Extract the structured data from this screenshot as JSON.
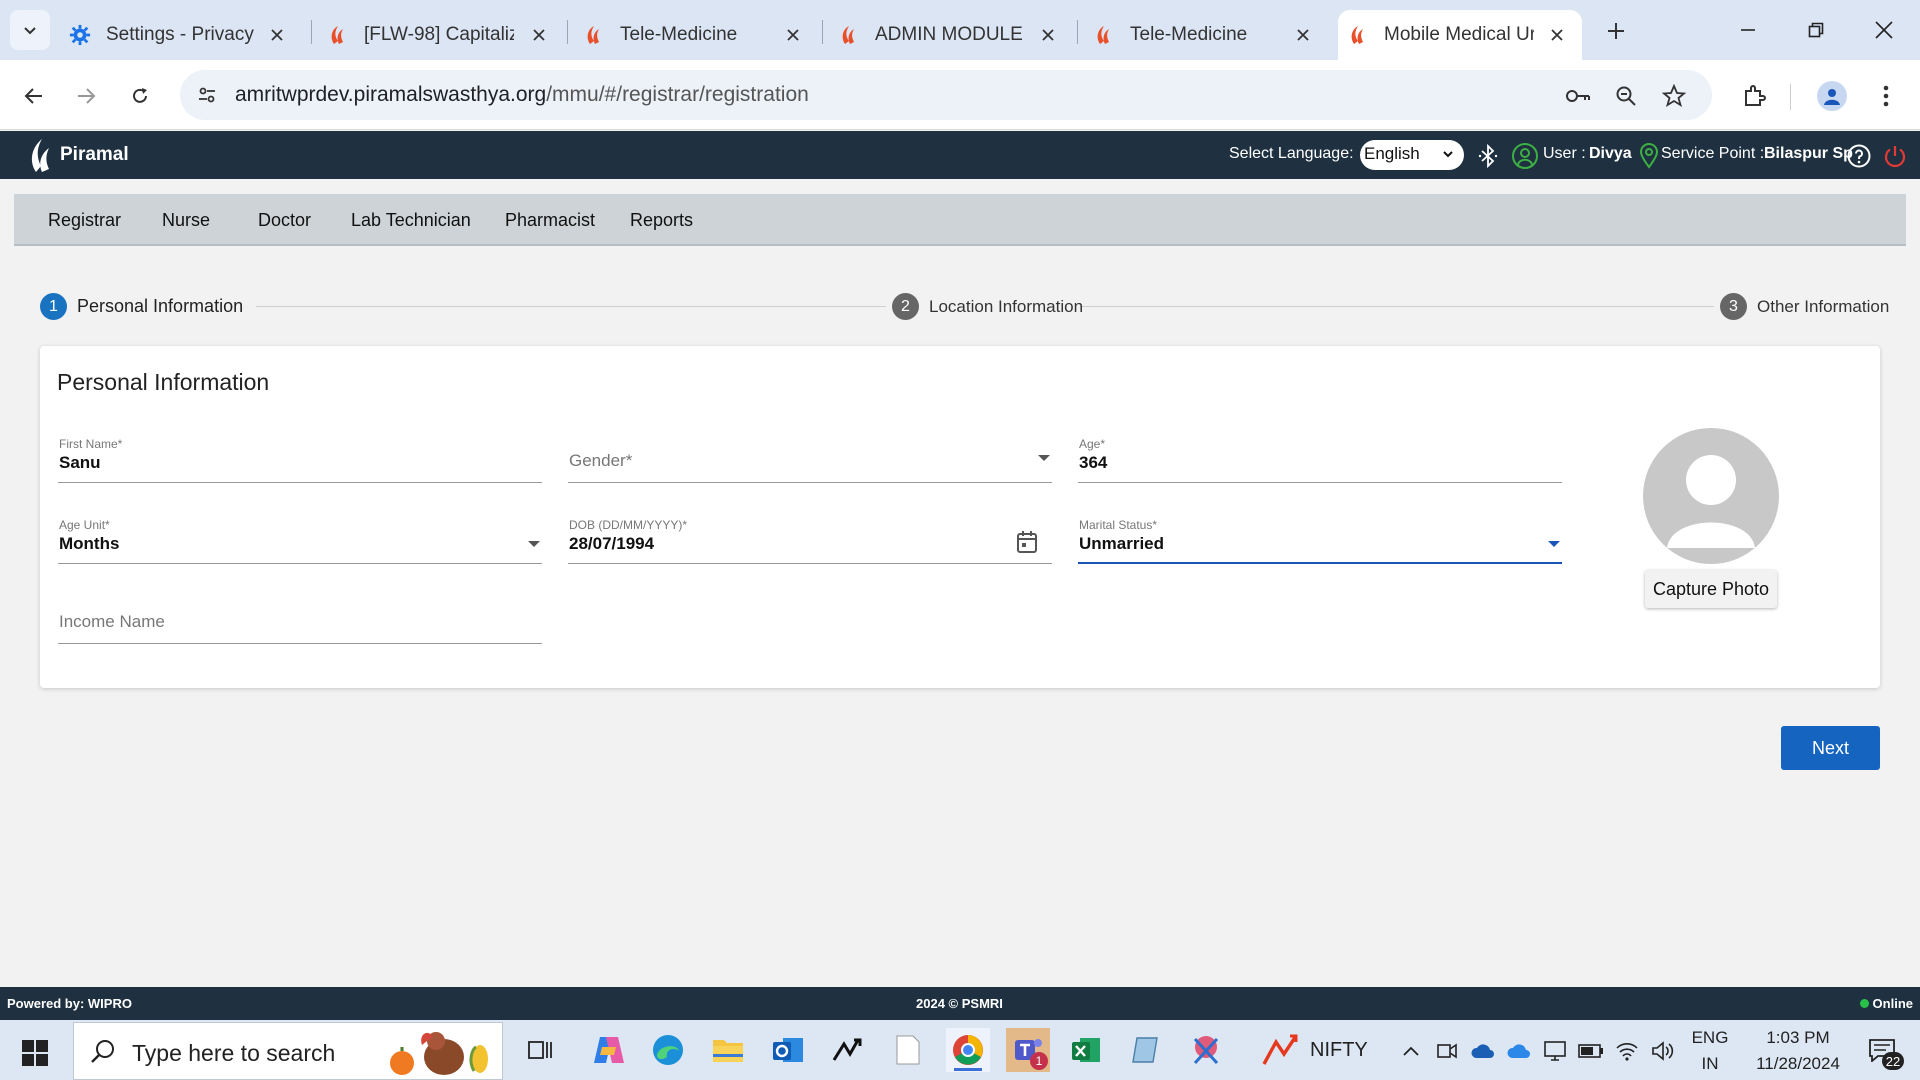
{
  "browser": {
    "tabs": [
      {
        "title": "Settings - Privacy a",
        "icon": "gear-icon"
      },
      {
        "title": "[FLW-98] Capitaliz",
        "icon": "piramal-icon"
      },
      {
        "title": "Tele-Medicine",
        "icon": "piramal-icon"
      },
      {
        "title": "ADMIN MODULE",
        "icon": "piramal-icon"
      },
      {
        "title": "Tele-Medicine",
        "icon": "piramal-icon"
      },
      {
        "title": "Mobile Medical Ur",
        "icon": "piramal-icon"
      }
    ],
    "active_tab_index": 5,
    "url_host": "amritwprdev.piramalswasthya.org",
    "url_path": "/mmu/#/registrar/registration"
  },
  "app_header": {
    "logo_text": "Piramal",
    "select_language_label": "Select Language:",
    "language_value": "English",
    "user_label": "User :",
    "user_name": "Divya",
    "service_point_label": "Service Point :",
    "service_point_value": "Bilaspur Sp"
  },
  "menu": {
    "items": [
      "Registrar",
      "Nurse",
      "Doctor",
      "Lab Technician",
      "Pharmacist",
      "Reports"
    ]
  },
  "stepper": {
    "steps": [
      {
        "num": "1",
        "label": "Personal Information",
        "active": true
      },
      {
        "num": "2",
        "label": "Location Information",
        "active": false
      },
      {
        "num": "3",
        "label": "Other Information",
        "active": false
      }
    ]
  },
  "form": {
    "title": "Personal Information",
    "first_name": {
      "label": "First Name*",
      "value": "Sanu"
    },
    "gender": {
      "placeholder": "Gender*",
      "value": ""
    },
    "age": {
      "label": "Age*",
      "value": "364"
    },
    "age_unit": {
      "label": "Age Unit*",
      "value": "Months"
    },
    "dob": {
      "label": "DOB (DD/MM/YYYY)*",
      "value": "28/07/1994"
    },
    "marital_status": {
      "label": "Marital Status*",
      "value": "Unmarried"
    },
    "income": {
      "placeholder": "Income Name",
      "value": ""
    },
    "capture_photo_label": "Capture Photo",
    "next_label": "Next"
  },
  "app_footer": {
    "powered_by": "Powered by: WIPRO",
    "copyright": "2024 © PSMRI",
    "status": "Online"
  },
  "taskbar": {
    "search_placeholder": "Type here to search",
    "stock_label": "NIFTY",
    "lang_top": "ENG",
    "lang_bottom": "IN",
    "time": "1:03 PM",
    "date": "11/28/2024",
    "notification_count": "22",
    "teams_badge": "1"
  },
  "colors": {
    "header_bg": "#1f3141",
    "primary": "#1565c0",
    "step_active": "#1a73c0",
    "online": "#29c04a"
  }
}
